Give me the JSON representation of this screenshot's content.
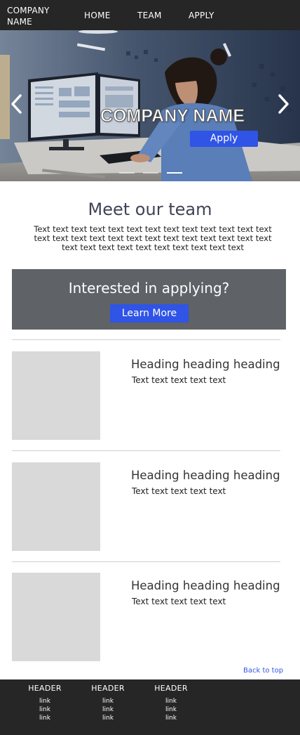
{
  "nav": {
    "brand": "COMPANY NAME",
    "links": [
      "HOME",
      "TEAM",
      "APPLY"
    ]
  },
  "hero": {
    "title": "COMPANY NAME",
    "button": "Apply",
    "active_slide": 3,
    "slide_count": 3,
    "prev_icon": "chevron-left-icon",
    "next_icon": "chevron-right-icon"
  },
  "meet": {
    "title": "Meet our team",
    "text": "Text text text text text text text text text text text text text text text text text text text text text text text text text text text text text text text text text text text text"
  },
  "banner": {
    "title": "Interested in applying?",
    "button": "Learn More"
  },
  "team": [
    {
      "heading": "Heading heading heading",
      "text": "Text text text text text"
    },
    {
      "heading": "Heading heading heading",
      "text": "Text text text text text"
    },
    {
      "heading": "Heading heading heading",
      "text": "Text text text text text"
    }
  ],
  "back_to_top": "Back to top",
  "footer": {
    "columns": [
      {
        "header": "HEADER",
        "links": [
          "link",
          "link",
          "link"
        ]
      },
      {
        "header": "HEADER",
        "links": [
          "link",
          "link",
          "link"
        ]
      },
      {
        "header": "HEADER",
        "links": [
          "link",
          "link",
          "link"
        ]
      }
    ]
  },
  "colors": {
    "nav_bg": "#262626",
    "accent": "#2f54e6",
    "banner_bg": "#5f6267",
    "placeholder": "#d9d9d9",
    "heading": "#3f4457"
  }
}
